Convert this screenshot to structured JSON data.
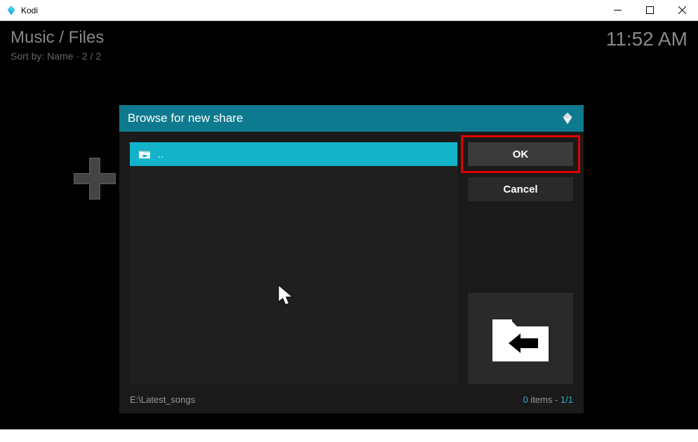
{
  "app": {
    "title": "Kodi"
  },
  "header": {
    "breadcrumb": "Music / Files",
    "sort_text": "Sort by: Name  ·  2 / 2",
    "time": "11:52 AM"
  },
  "dialog": {
    "title": "Browse for new share",
    "list": {
      "items": [
        {
          "label": ".."
        }
      ]
    },
    "buttons": {
      "ok": "OK",
      "cancel": "Cancel"
    },
    "footer": {
      "path": "E:\\Latest_songs",
      "items_count": "0",
      "items_word": " items - ",
      "page": "1/1"
    }
  }
}
